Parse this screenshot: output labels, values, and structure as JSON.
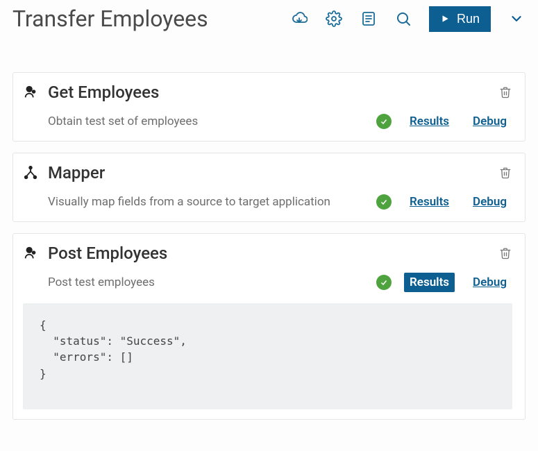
{
  "page": {
    "title": "Transfer Employees",
    "run_label": "Run"
  },
  "steps": [
    {
      "title": "Get Employees",
      "desc": "Obtain test set of employees",
      "results_label": "Results",
      "debug_label": "Debug",
      "results_active": false,
      "icon": "head"
    },
    {
      "title": "Mapper",
      "desc": "Visually map fields from a source to target application",
      "results_label": "Results",
      "debug_label": "Debug",
      "results_active": false,
      "icon": "mapper"
    },
    {
      "title": "Post Employees",
      "desc": "Post test employees",
      "results_label": "Results",
      "debug_label": "Debug",
      "results_active": true,
      "icon": "head",
      "payload": "{\n  \"status\": \"Success\",\n  \"errors\": []\n}"
    }
  ]
}
